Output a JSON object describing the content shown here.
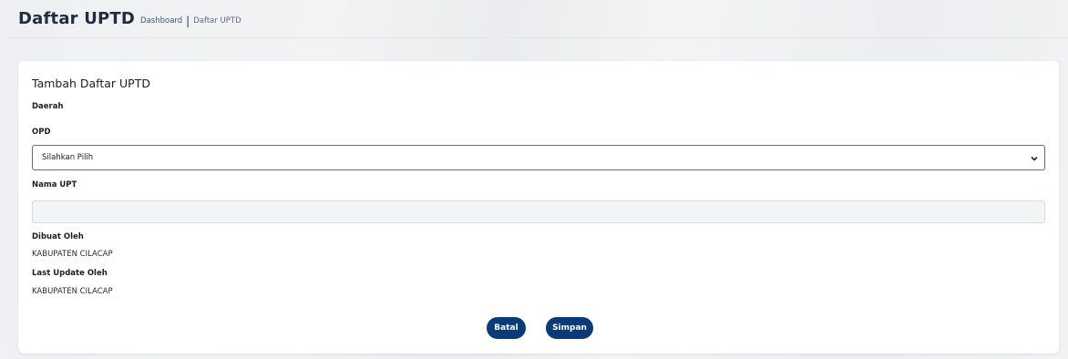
{
  "header": {
    "title": "Daftar UPTD",
    "breadcrumb": {
      "home": "Dashboard",
      "separator": "|",
      "current": "Daftar UPTD"
    }
  },
  "form": {
    "title": "Tambah Daftar UPTD",
    "daerah_label": "Daerah",
    "opd_label": "OPD",
    "opd_selected": "Silahkan Pilih",
    "nama_upt_label": "Nama UPT",
    "nama_upt_value": "",
    "dibuat_oleh_label": "Dibuat Oleh",
    "dibuat_oleh_value": "KABUPATEN CILACAP",
    "last_update_label": "Last Update Oleh",
    "last_update_value": "KABUPATEN CILACAP"
  },
  "actions": {
    "batal": "Batal",
    "simpan": "Simpan"
  },
  "colors": {
    "button": "#0b3b76",
    "card": "#ffffff"
  }
}
